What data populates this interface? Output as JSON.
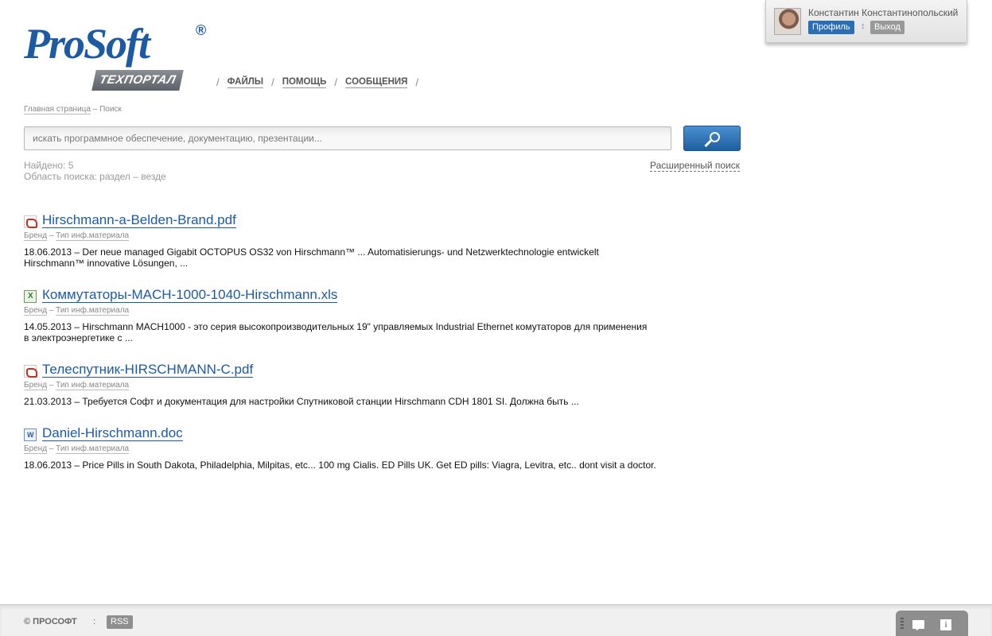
{
  "brand": {
    "name": "ProSoft",
    "reg": "®",
    "subtitle": "ТЕХПОРТАЛ"
  },
  "nav": {
    "items": [
      {
        "label": "ФАЙЛЫ"
      },
      {
        "label": "ПОМОЩЬ"
      },
      {
        "label": "СООБЩЕНИЯ"
      }
    ]
  },
  "user": {
    "name": "Константин Константинопольский",
    "profile_label": "Профиль",
    "divider": "↕",
    "logout_label": "Выход"
  },
  "breadcrumb": {
    "home": "Главная страница",
    "sep": " – ",
    "current": "Поиск"
  },
  "search": {
    "placeholder": "искать программное обеспечение, документацию, презентации...",
    "value": ""
  },
  "results_meta": {
    "found": "Найдено: 5",
    "scope": "Область поиска: раздел – везде",
    "advanced_label": "Расширенный поиск"
  },
  "results": [
    {
      "icon": "pdf-file-icon",
      "title": "Hirschmann-a-Belden-Brand.pdf",
      "cat1": "Бренд",
      "sep": " – ",
      "cat2": "Тип инф.материала",
      "desc": "18.06.2013 – Der neue managed Gigabit OCTOPUS OS32 von Hirschmann™ ... Automatisierungs- und Netzwerktechnologie entwickelt Hirschmann™ innovative Lösungen, ..."
    },
    {
      "icon": "xls-file-icon",
      "title": "Коммутаторы-MACH-1000-1040-Hirschmann.xls",
      "cat1": "Бренд",
      "sep": " – ",
      "cat2": "Тип инф.материала",
      "desc": "14.05.2013 – Hirschmann MACH1000 - это серия высокопроизводительных 19\" управляемых Industrial Ethernet комутаторов для применения в электроэнергетике с ..."
    },
    {
      "icon": "pdf-file-icon",
      "title": "Телеспутник-HIRSCHMANN-C.pdf",
      "cat1": "Бренд",
      "sep": " – ",
      "cat2": "Тип инф.материала",
      "desc": "21.03.2013 – Требуется Софт и документация для настройки Спутниковой станции Hirschmann CDH 1801 SI. Должна быть ..."
    },
    {
      "icon": "doc-file-icon",
      "title": "Daniel-Hirschmann.doc",
      "cat1": "Бренд",
      "sep": " – ",
      "cat2": "Тип инф.материала",
      "desc": "18.06.2013 – Price Pills in South Dakota, Philadelphia, Milpitas, etc... 100 mg Cialis. ED Pills UK. Get ED pills: Viagra, Levitra, etc.. dont visit a doctor."
    }
  ],
  "footer": {
    "copyright": "© ПРОСОФТ",
    "divider": ":",
    "rss_label": "RSS"
  },
  "colors": {
    "accent": "#1d5aa6",
    "button": "#2c6eb4"
  }
}
